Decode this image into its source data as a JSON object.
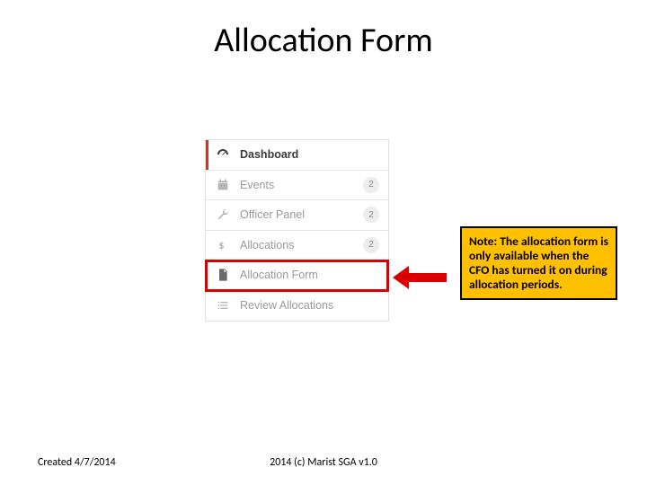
{
  "title": "Allocation Form",
  "menu": {
    "items": [
      {
        "label": "Dashboard",
        "badge": ""
      },
      {
        "label": "Events",
        "badge": "2"
      },
      {
        "label": "Officer Panel",
        "badge": "2"
      },
      {
        "label": "Allocations",
        "badge": "2"
      },
      {
        "label": "Allocation Form",
        "badge": ""
      },
      {
        "label": "Review Allocations",
        "badge": ""
      }
    ]
  },
  "note": "Note: The allocation form is only available when the CFO has turned it on during allocation periods.",
  "footer": {
    "created": "Created 4/7/2014",
    "copyright": "2014 (c) Marist SGA v1.0"
  },
  "colors": {
    "accent": "#c0392b",
    "highlight": "#d90000",
    "noteBg": "#ffc000"
  }
}
